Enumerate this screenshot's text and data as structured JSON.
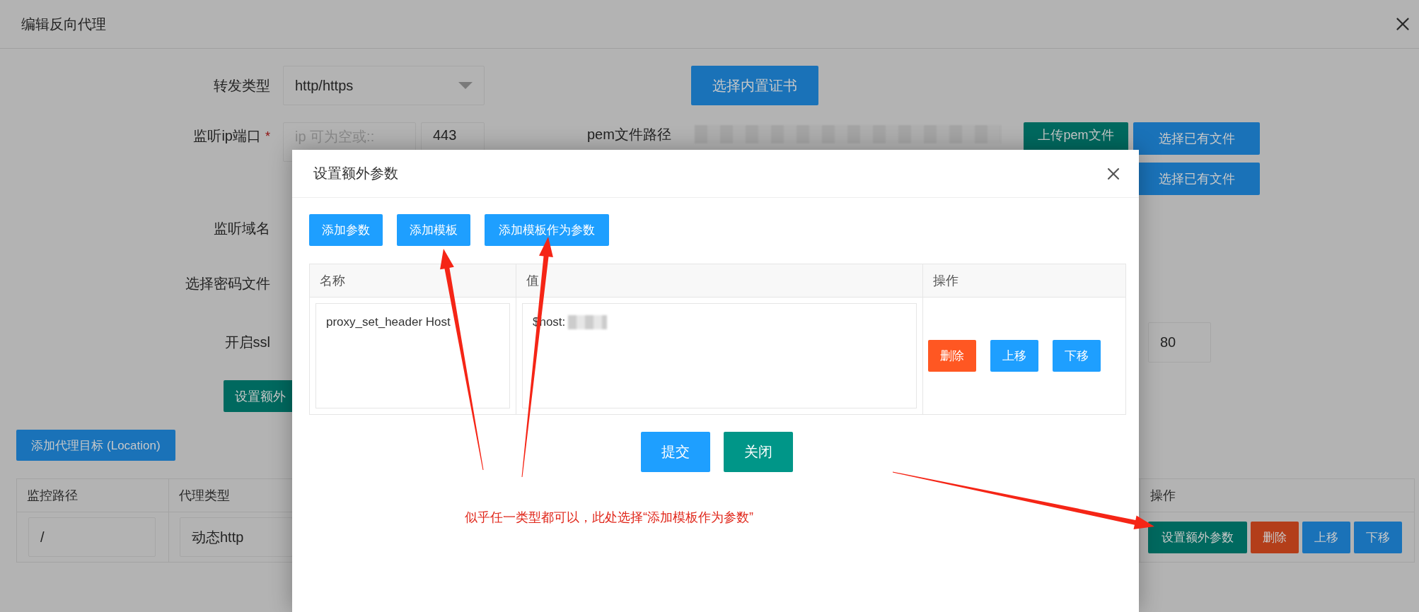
{
  "window": {
    "title": "编辑反向代理"
  },
  "form": {
    "forward_type": {
      "label": "转发类型",
      "value": "http/https"
    },
    "builtin_cert_button": "选择内置证书",
    "listen": {
      "label": "监听ip端口",
      "required_mark": "*",
      "ip_placeholder": "ip 可为空或::",
      "port": "443"
    },
    "pem": {
      "label": "pem文件路径",
      "redacted": true,
      "upload_button": "上传pem文件",
      "choose_buttons": [
        "选择已有文件",
        "选择已有文件"
      ]
    },
    "domain_label": "监听域名",
    "password_label": "选择密码文件",
    "ssl_label": "开启ssl",
    "ssl_port": "80",
    "extra_button": "设置额外"
  },
  "location_button": "添加代理目标 (Location)",
  "locations": {
    "columns": [
      "监控路径",
      "代理类型",
      "操作"
    ],
    "rows": [
      {
        "path": "/",
        "type": "动态http",
        "actions": [
          {
            "label": "设置额外参数",
            "kind": "extra"
          },
          {
            "label": "删除",
            "kind": "danger"
          },
          {
            "label": "上移",
            "kind": "normal"
          },
          {
            "label": "下移",
            "kind": "normal"
          }
        ]
      }
    ]
  },
  "dialog": {
    "title": "设置额外参数",
    "toolbar": [
      "添加参数",
      "添加模板",
      "添加模板作为参数"
    ],
    "columns": [
      "名称",
      "值",
      "操作"
    ],
    "rows": [
      {
        "name": "proxy_set_header Host",
        "value": "$host:",
        "redacted": true,
        "actions": [
          {
            "label": "删除",
            "kind": "danger"
          },
          {
            "label": "上移",
            "kind": "normal"
          },
          {
            "label": "下移",
            "kind": "normal"
          }
        ]
      }
    ],
    "footer": [
      {
        "label": "提交",
        "kind": "primary"
      },
      {
        "label": "关闭",
        "kind": "secondary"
      }
    ]
  },
  "annotation": {
    "text": "似乎任一类型都可以，此处选择“添加模板作为参数”"
  }
}
